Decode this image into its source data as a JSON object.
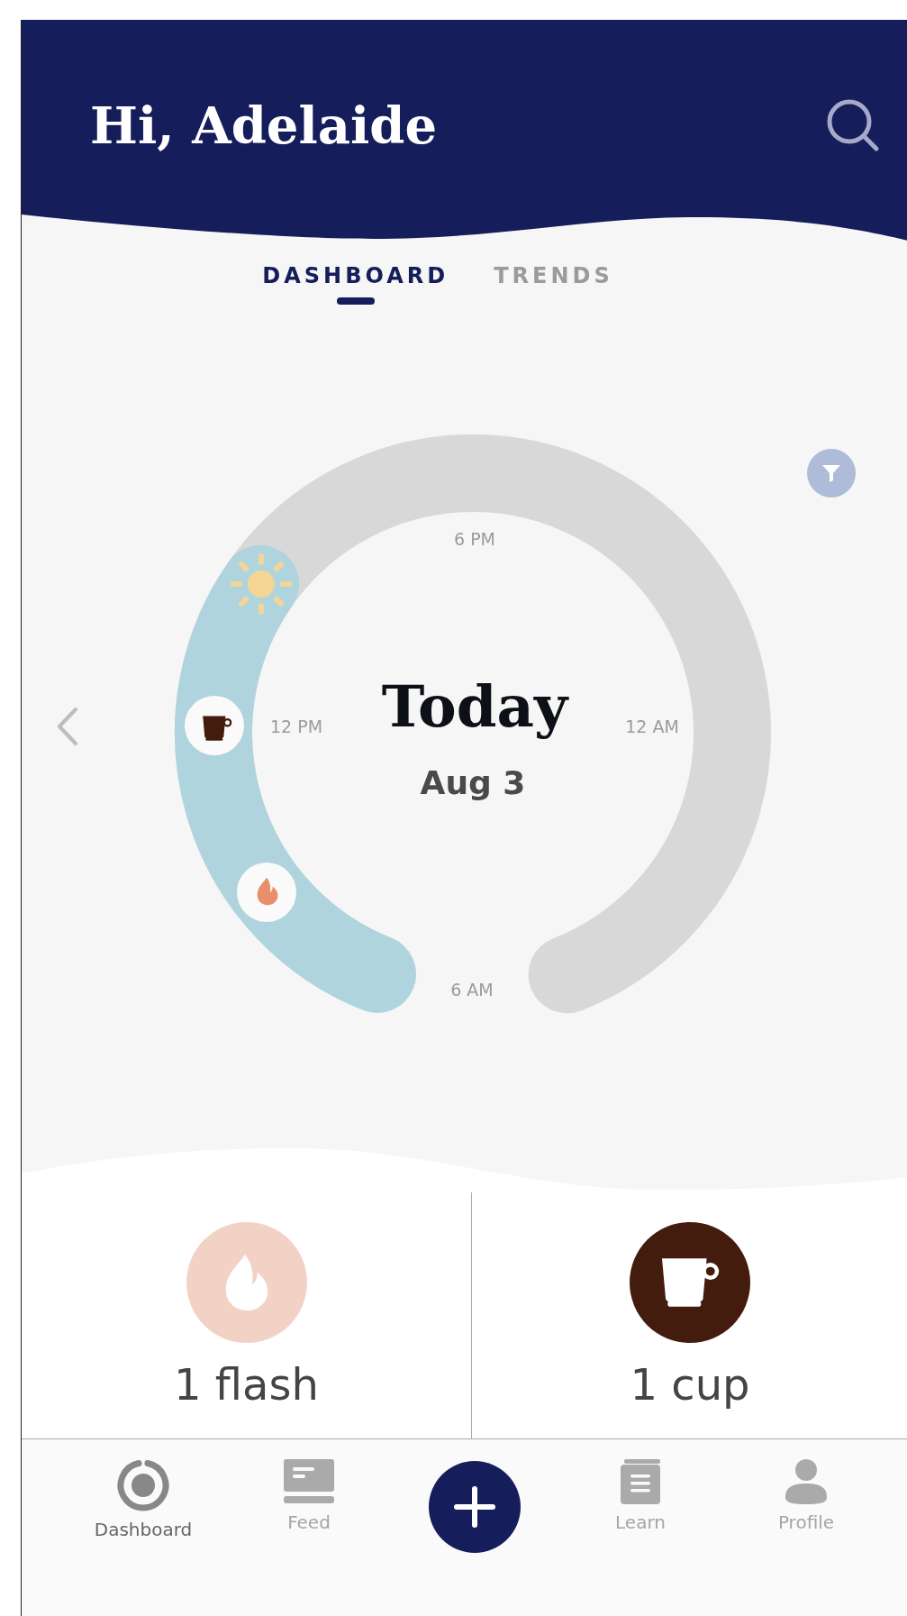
{
  "header": {
    "greeting": "Hi, Adelaide"
  },
  "tabs": [
    {
      "label": "DASHBOARD",
      "selected": true
    },
    {
      "label": "TRENDS",
      "selected": false
    }
  ],
  "clock": {
    "title": "Today",
    "date": "Aug 3",
    "hour_labels": [
      "6 PM",
      "12 PM",
      "12 AM",
      "6 AM"
    ],
    "markers": [
      {
        "kind": "sun"
      },
      {
        "kind": "cup"
      },
      {
        "kind": "flame"
      }
    ]
  },
  "summary": [
    {
      "kind": "flame",
      "text": "1 flash",
      "color": "#f3d2c6"
    },
    {
      "kind": "cup",
      "text": "1 cup",
      "color": "#441c0d"
    }
  ],
  "nav": [
    {
      "kind": "ring",
      "label": "Dashboard",
      "selected": true
    },
    {
      "kind": "feed",
      "label": "Feed",
      "selected": false
    },
    {
      "kind": "add"
    },
    {
      "kind": "book",
      "label": "Learn",
      "selected": false
    },
    {
      "kind": "person",
      "label": "Profile",
      "selected": false
    }
  ]
}
